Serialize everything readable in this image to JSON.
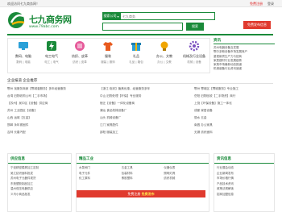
{
  "topbar": {
    "welcome": "欢迎访问七九商务网！",
    "links": [
      "免费注册",
      "登录"
    ]
  },
  "logo": {
    "name": "七九商务网",
    "url": "www.79abc.com"
  },
  "search": {
    "category_label": "搜索公司",
    "placeholder": "七九商务",
    "button": "搜索"
  },
  "register_button": "免费发布信息",
  "categories": [
    {
      "name": "数码、电脑",
      "sub": "数码 | 电脑"
    },
    {
      "name": "电工电气",
      "sub": "电工 | 电气"
    },
    {
      "name": "纺织、皮革",
      "sub": "纺织 | 皮革"
    },
    {
      "name": "服装",
      "sub": "服装 | 服饰"
    },
    {
      "name": "礼品",
      "sub": "礼品 | 箱包"
    },
    {
      "name": "办公、文教",
      "sub": "办公 | 文教"
    },
    {
      "name": "机械及行业设备",
      "sub": "机械 | 设备"
    }
  ],
  "news": {
    "title": "资讯",
    "items": [
      "苏州电器设备互发展",
      "鄂尔多斯设备市场发展商户",
      "重视新质生产力与招商",
      "家居建材行业发展趋势",
      "家具市场最新动态报道",
      "机械装备行业资讯速递"
    ]
  },
  "section": {
    "title": "企业报道 企业推荐"
  },
  "listing": [
    [
      "鄂州 找服务商家【鄂城普服务】多年经营服务",
      "【浙江 临安】聚焦优惠，经营服务多年",
      "鄂州 鄂城区【鄂城服务】专业施工"
    ],
    [
      "台湾 旧物收购公司【二手市场】",
      "中山 旧物处理【环保】专业服务",
      "岳阳 旧物回收【二手物资】商行"
    ],
    [
      "【苏州】吴中区【设备】供应商",
      "宿迁【设备】一体化设备商",
      "上饶【环保设备】施工一体化"
    ],
    [
      "苏州 工业园区【设备】",
      "潮汕 食品机械设备厂",
      "成都 家居设备"
    ],
    [
      "山西 运城【五金】",
      "汕头 机械设备厂",
      "丽水 五金"
    ],
    [
      "邯郸 永年紧固件",
      "江门 家具配件",
      "南昌 办公家具"
    ],
    [
      "吉林 长春汽配",
      "邵阳 服装加工",
      "无锡 纺织面料"
    ]
  ],
  "bottom": [
    {
      "title": "供应信息",
      "items": [
        "宁波精密模具加工定制",
        "吴江纺织面料批发",
        "苏州电子元器件现货",
        "东莞塑胶制品加工",
        "温州低压电器供应",
        "义乌小商品批发"
      ]
    },
    {
      "title": "精品工业",
      "items": [
        "水泵阀门",
        "五金工具",
        "仪器仪表",
        "电子元件",
        "包装材料",
        "照明灯具",
        "化工原料",
        "橡胶塑料",
        "纺织机械"
      ]
    },
    {
      "title": "资讯信息",
      "items": [
        "行业展会动态",
        "企业新闻发布",
        "市场价格行情",
        "产品技术资讯",
        "政策法规解读",
        "招商加盟信息"
      ]
    }
  ],
  "popup": {
    "text": "免费注册",
    "cta": "免费发布"
  }
}
